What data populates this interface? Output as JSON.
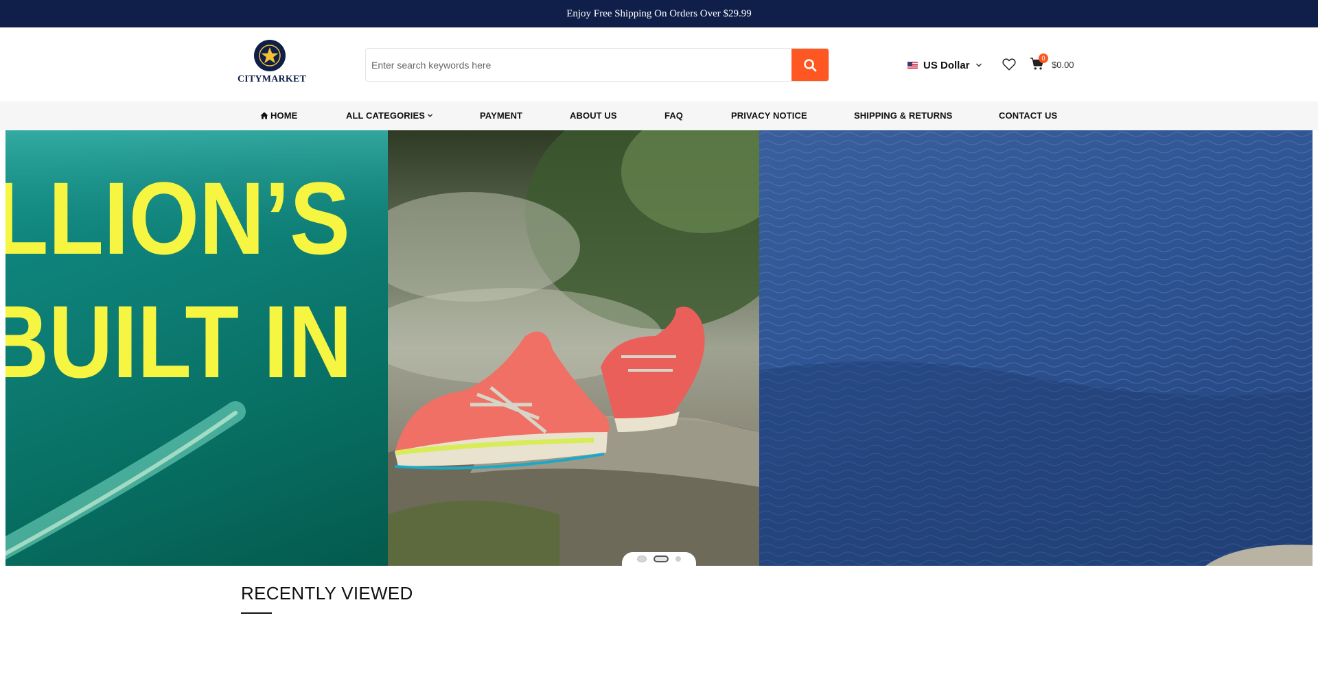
{
  "announcement": "Enjoy Free Shipping On Orders Over $29.99",
  "logo": {
    "text": "CITYMARKET"
  },
  "search": {
    "placeholder": "Enter search keywords here",
    "button_icon": "search-icon"
  },
  "currency": {
    "label": "US Dollar",
    "flag": "us-flag-icon"
  },
  "cart": {
    "count": "0",
    "total": "$0.00"
  },
  "nav": {
    "home": "HOME",
    "all_categories": "ALL CATEGORIES",
    "payment": "PAYMENT",
    "about_us": "ABOUT US",
    "faq": "FAQ",
    "privacy_notice": "PRIVACY NOTICE",
    "shipping_returns": "SHIPPING & RETURNS",
    "contact_us": "CONTACT US"
  },
  "hero": {
    "slide_text_line1": "LLION’S",
    "slide_text_line2": "BUILT IN",
    "active_slide": 2,
    "slide_count": 3
  },
  "recently_viewed": {
    "title": "RECENTLY VIEWED"
  },
  "colors": {
    "topbar": "#0f1f49",
    "accent": "#ff5722",
    "nav_bg": "#f6f6f6",
    "hero_text": "#f5f542"
  }
}
